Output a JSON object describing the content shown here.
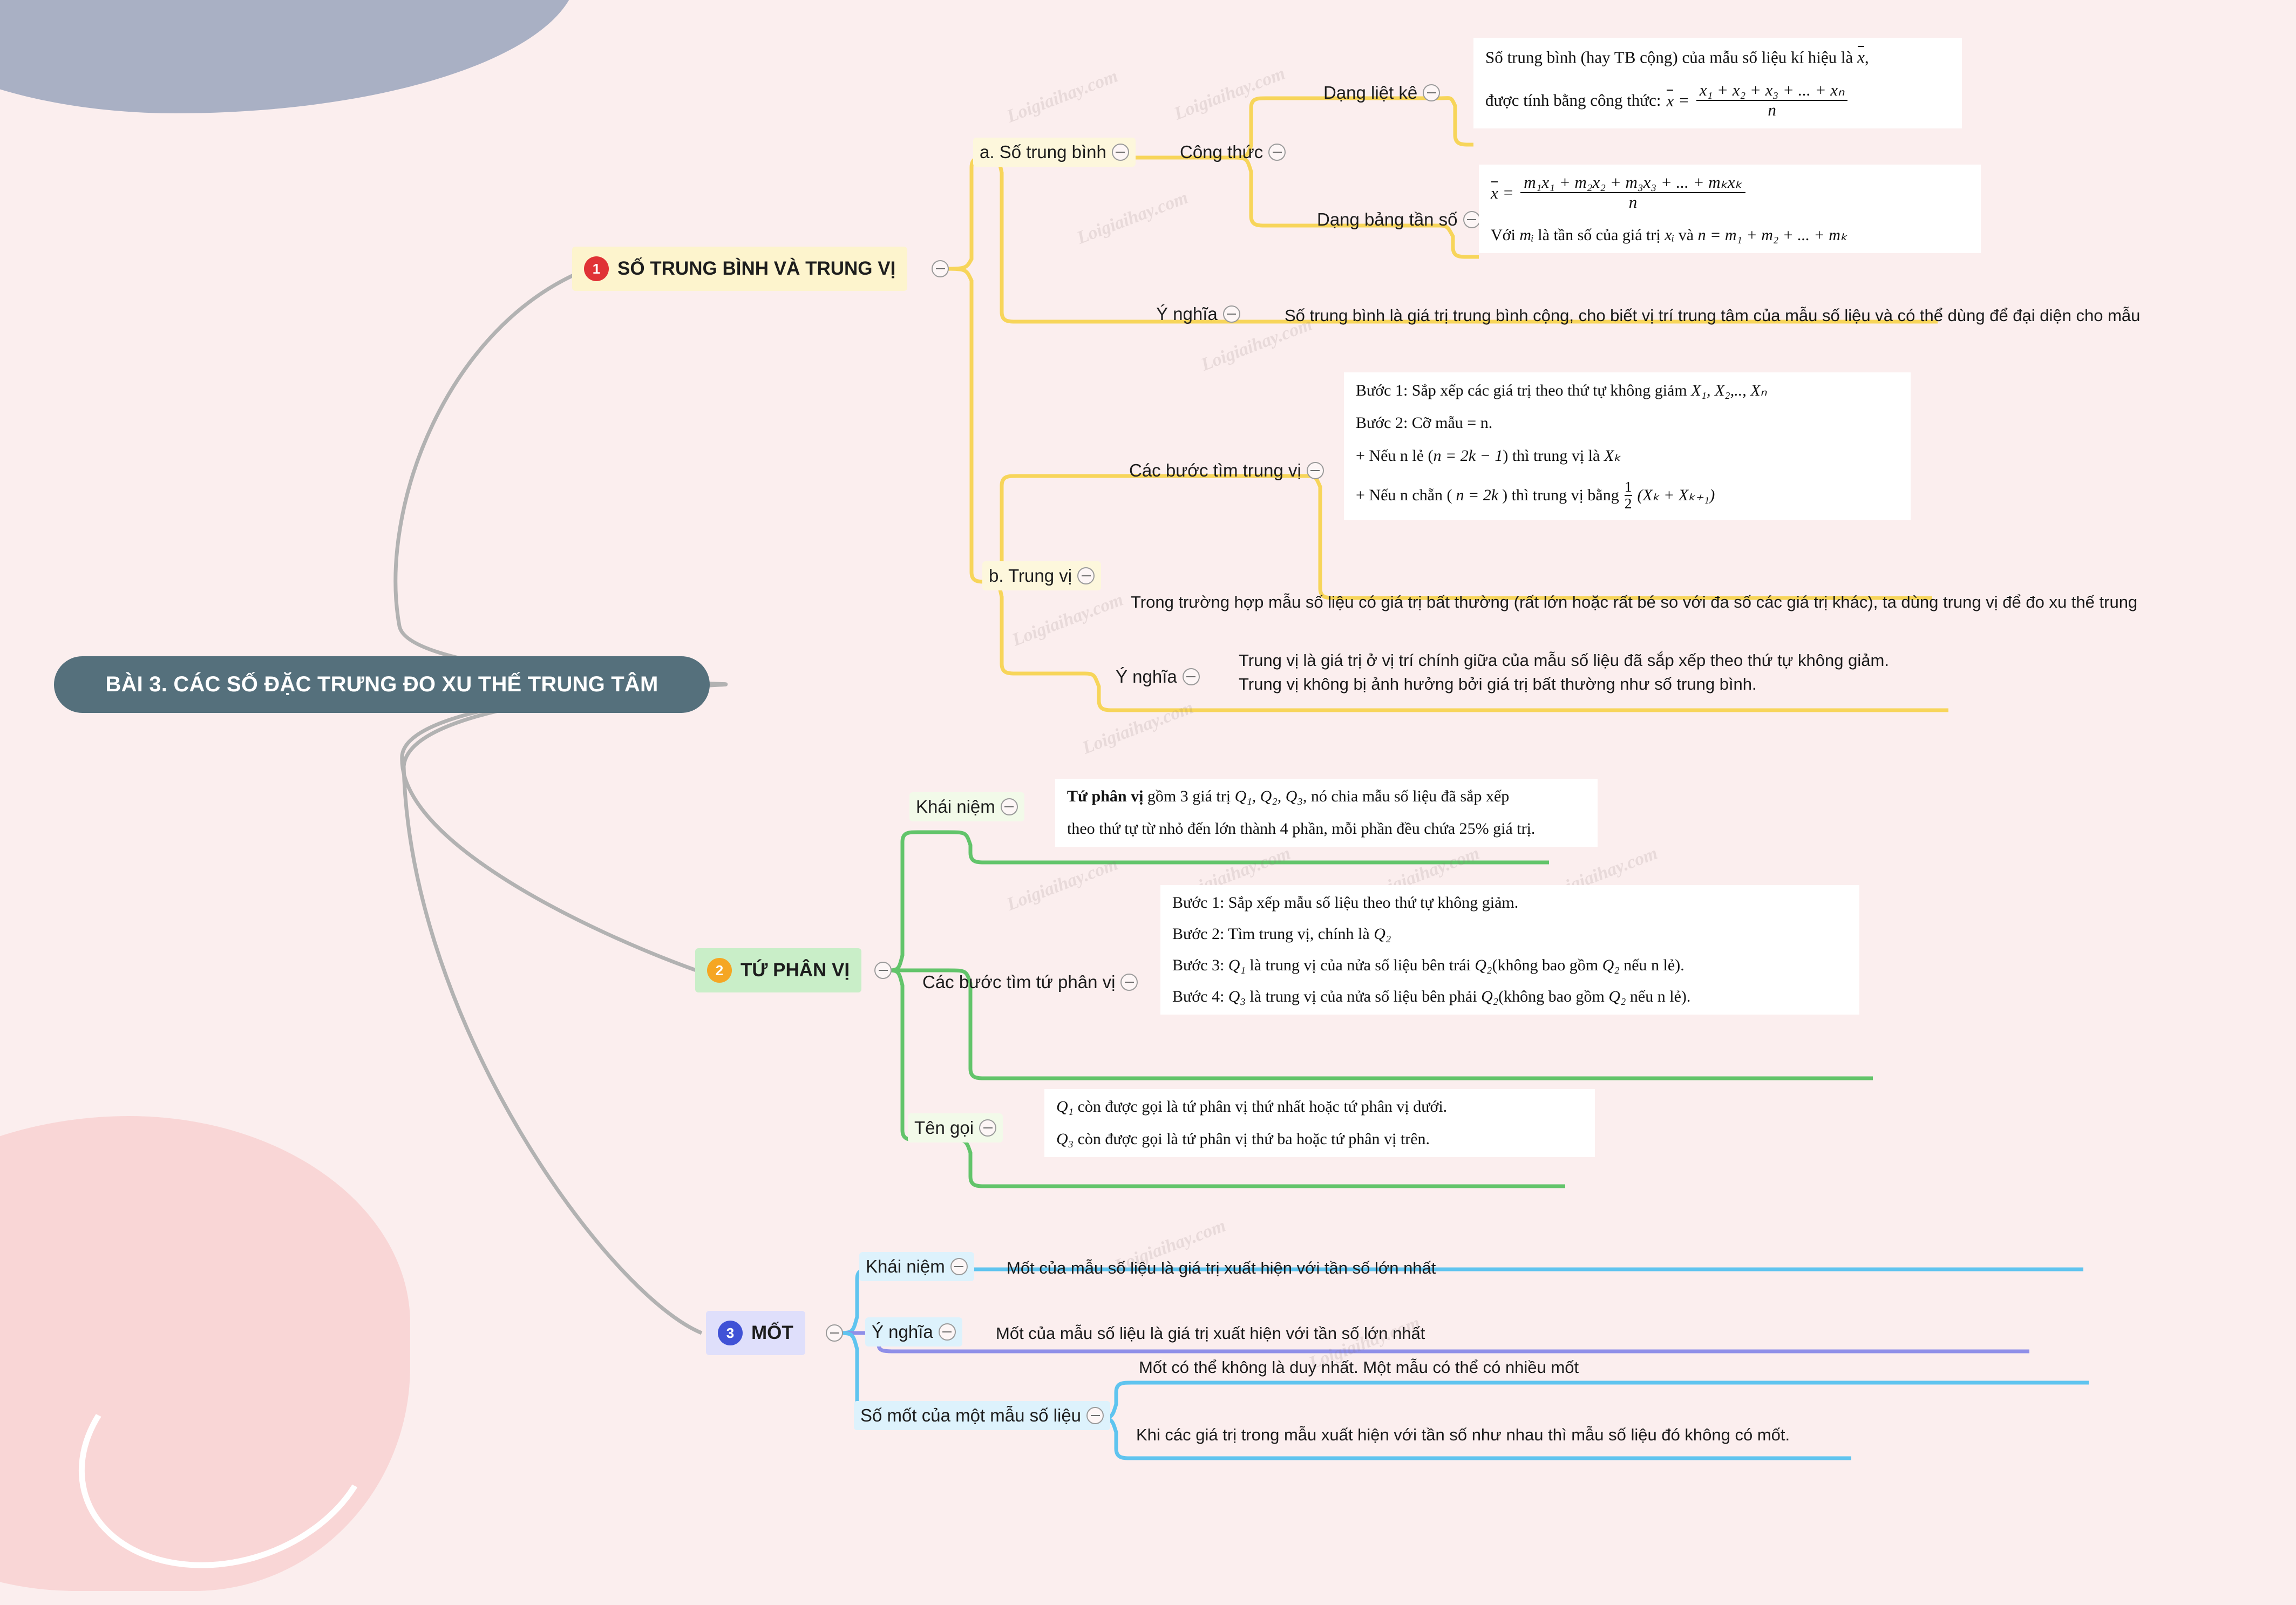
{
  "root": {
    "title": "BÀI 3. CÁC SỐ ĐẶC TRƯNG ĐO XU THẾ TRUNG TÂM"
  },
  "watermark": {
    "text": "Loigiaihay.com"
  },
  "branches": [
    {
      "index": "1",
      "title": "SỐ TRUNG BÌNH VÀ TRUNG VỊ",
      "color": "#f7d55a",
      "children": [
        {
          "label": "a. Số trung bình",
          "children": [
            {
              "label": "Công thức",
              "children": [
                {
                  "label": "Dạng liệt kê"
                },
                {
                  "label": "Dạng bảng tần số"
                }
              ]
            },
            {
              "label": "Ý nghĩa",
              "text": "Số trung bình là giá trị trung bình cộng, cho biết vị trí trung tâm của mẫu số liệu và có thể dùng để đại diện cho mẫu"
            }
          ]
        },
        {
          "label": "b. Trung vị",
          "children": [
            {
              "label": "Các bước tìm trung vị"
            },
            {
              "label": "",
              "text": "Trong trường hợp mẫu số liệu có giá trị bất thường (rất lớn hoặc rất bé so với đa số các giá trị khác), ta dùng trung vị để đo xu thế trung"
            },
            {
              "label": "Ý nghĩa",
              "line1": "Trung vị là giá trị ở vị trí chính giữa của mẫu số liệu đã sắp xếp theo thứ tự không giảm.",
              "line2": "Trung vị không bị ảnh hưởng bởi giá trị bất thường như số trung bình."
            }
          ]
        }
      ]
    },
    {
      "index": "2",
      "title": "TỨ PHÂN VỊ",
      "color": "#62c46a",
      "children": [
        {
          "label": "Khái niệm"
        },
        {
          "label": "Các bước tìm tứ phân vị"
        },
        {
          "label": "Tên gọi"
        }
      ]
    },
    {
      "index": "3",
      "title": "MỐT",
      "color": "#5fc4ef",
      "children": [
        {
          "label": "Khái niệm",
          "text": "Mốt của mẫu số liệu là giá trị xuất hiện với tần số lớn nhất"
        },
        {
          "label": "Ý nghĩa",
          "text": "Mốt của mẫu số liệu là giá trị xuất hiện với tần số lớn nhất"
        },
        {
          "label": "Số mốt của một mẫu số liệu",
          "line1": "Mốt có thể không là duy nhất. Một mẫu có thể có nhiều mốt",
          "line2": "Khi các giá trị trong mẫu xuất hiện với tần số như nhau thì mẫu số liệu đó không có mốt."
        }
      ]
    }
  ],
  "cards": {
    "mean_list": {
      "line1_a": "Số trung bình (hay TB cộng) của mẫu số liệu kí hiệu là",
      "line1_sym": "x",
      "line1_b": ",",
      "line2_a": "được tính bằng công thức:",
      "line2_lhs": "x",
      "line2_eq": "=",
      "line2_num": "x₁ + x₂ + x₃ + ... + xₙ",
      "line2_den": "n"
    },
    "mean_freq": {
      "lhs": "x",
      "eq": "=",
      "num": "m₁x₁ + m₂x₂ + m₃x₃ + ... + mₖxₖ",
      "den": "n",
      "note_a": "Với",
      "note_mi": "mᵢ",
      "note_b": "là tần số của giá trị",
      "note_xi": "xᵢ",
      "note_c": "và",
      "note_eq": "n = m₁ + m₂ + ... + mₖ"
    },
    "median_steps": {
      "step1": "Bước 1: Sắp xếp các giá trị theo thứ tự không giảm",
      "step1_sym": "X₁, X₂,.., Xₙ",
      "step2": "Bước 2: Cỡ mẫu = n.",
      "odd_a": "+ Nếu n lẻ (",
      "odd_eq": "n = 2k − 1",
      "odd_b": ") thì trung vị là",
      "odd_sym": "Xₖ",
      "even_a": "+ Nếu n chẵn (",
      "even_eq": "n = 2k",
      "even_b": ") thì trung vị bằng",
      "even_frac_num": "1",
      "even_frac_den": "2",
      "even_tail": "(Xₖ + Xₖ₊₁)"
    },
    "quartile_concept": {
      "bold": "Tứ phân vị",
      "line1_a": "gồm 3 giá trị",
      "line1_sym": "Q₁, Q₂, Q₃",
      "line1_b": ", nó chia mẫu số liệu đã sắp xếp",
      "line2": "theo thứ tự từ nhỏ đến lớn thành 4 phần, mỗi phần đều chứa 25% giá trị."
    },
    "quartile_steps": {
      "step1": "Bước 1: Sắp xếp mẫu số liệu theo thứ tự không giảm.",
      "step2_a": "Bước 2: Tìm trung vị, chính là",
      "step2_sym": "Q₂",
      "step3_a": "Bước 3:",
      "step3_q": "Q₁",
      "step3_b": "là trung vị của nửa số liệu bên trái",
      "step3_q2": "Q₂",
      "step3_c": "(không bao gồm",
      "step3_q3": "Q₂",
      "step3_d": "nếu n lẻ).",
      "step4_a": "Bước 4:",
      "step4_q": "Q₃",
      "step4_b": "là trung vị của nửa số liệu bên phải",
      "step4_q2": "Q₂",
      "step4_c": "(không bao gồm",
      "step4_q3": "Q₂",
      "step4_d": "nếu n lẻ)."
    },
    "quartile_names": {
      "line1_q": "Q₁",
      "line1_t": "còn được gọi là tứ phân vị thứ nhất hoặc tứ phân vị dưới.",
      "line2_q": "Q₃",
      "line2_t": "còn được gọi là tứ phân vị thứ ba hoặc tứ phân vị trên."
    }
  }
}
